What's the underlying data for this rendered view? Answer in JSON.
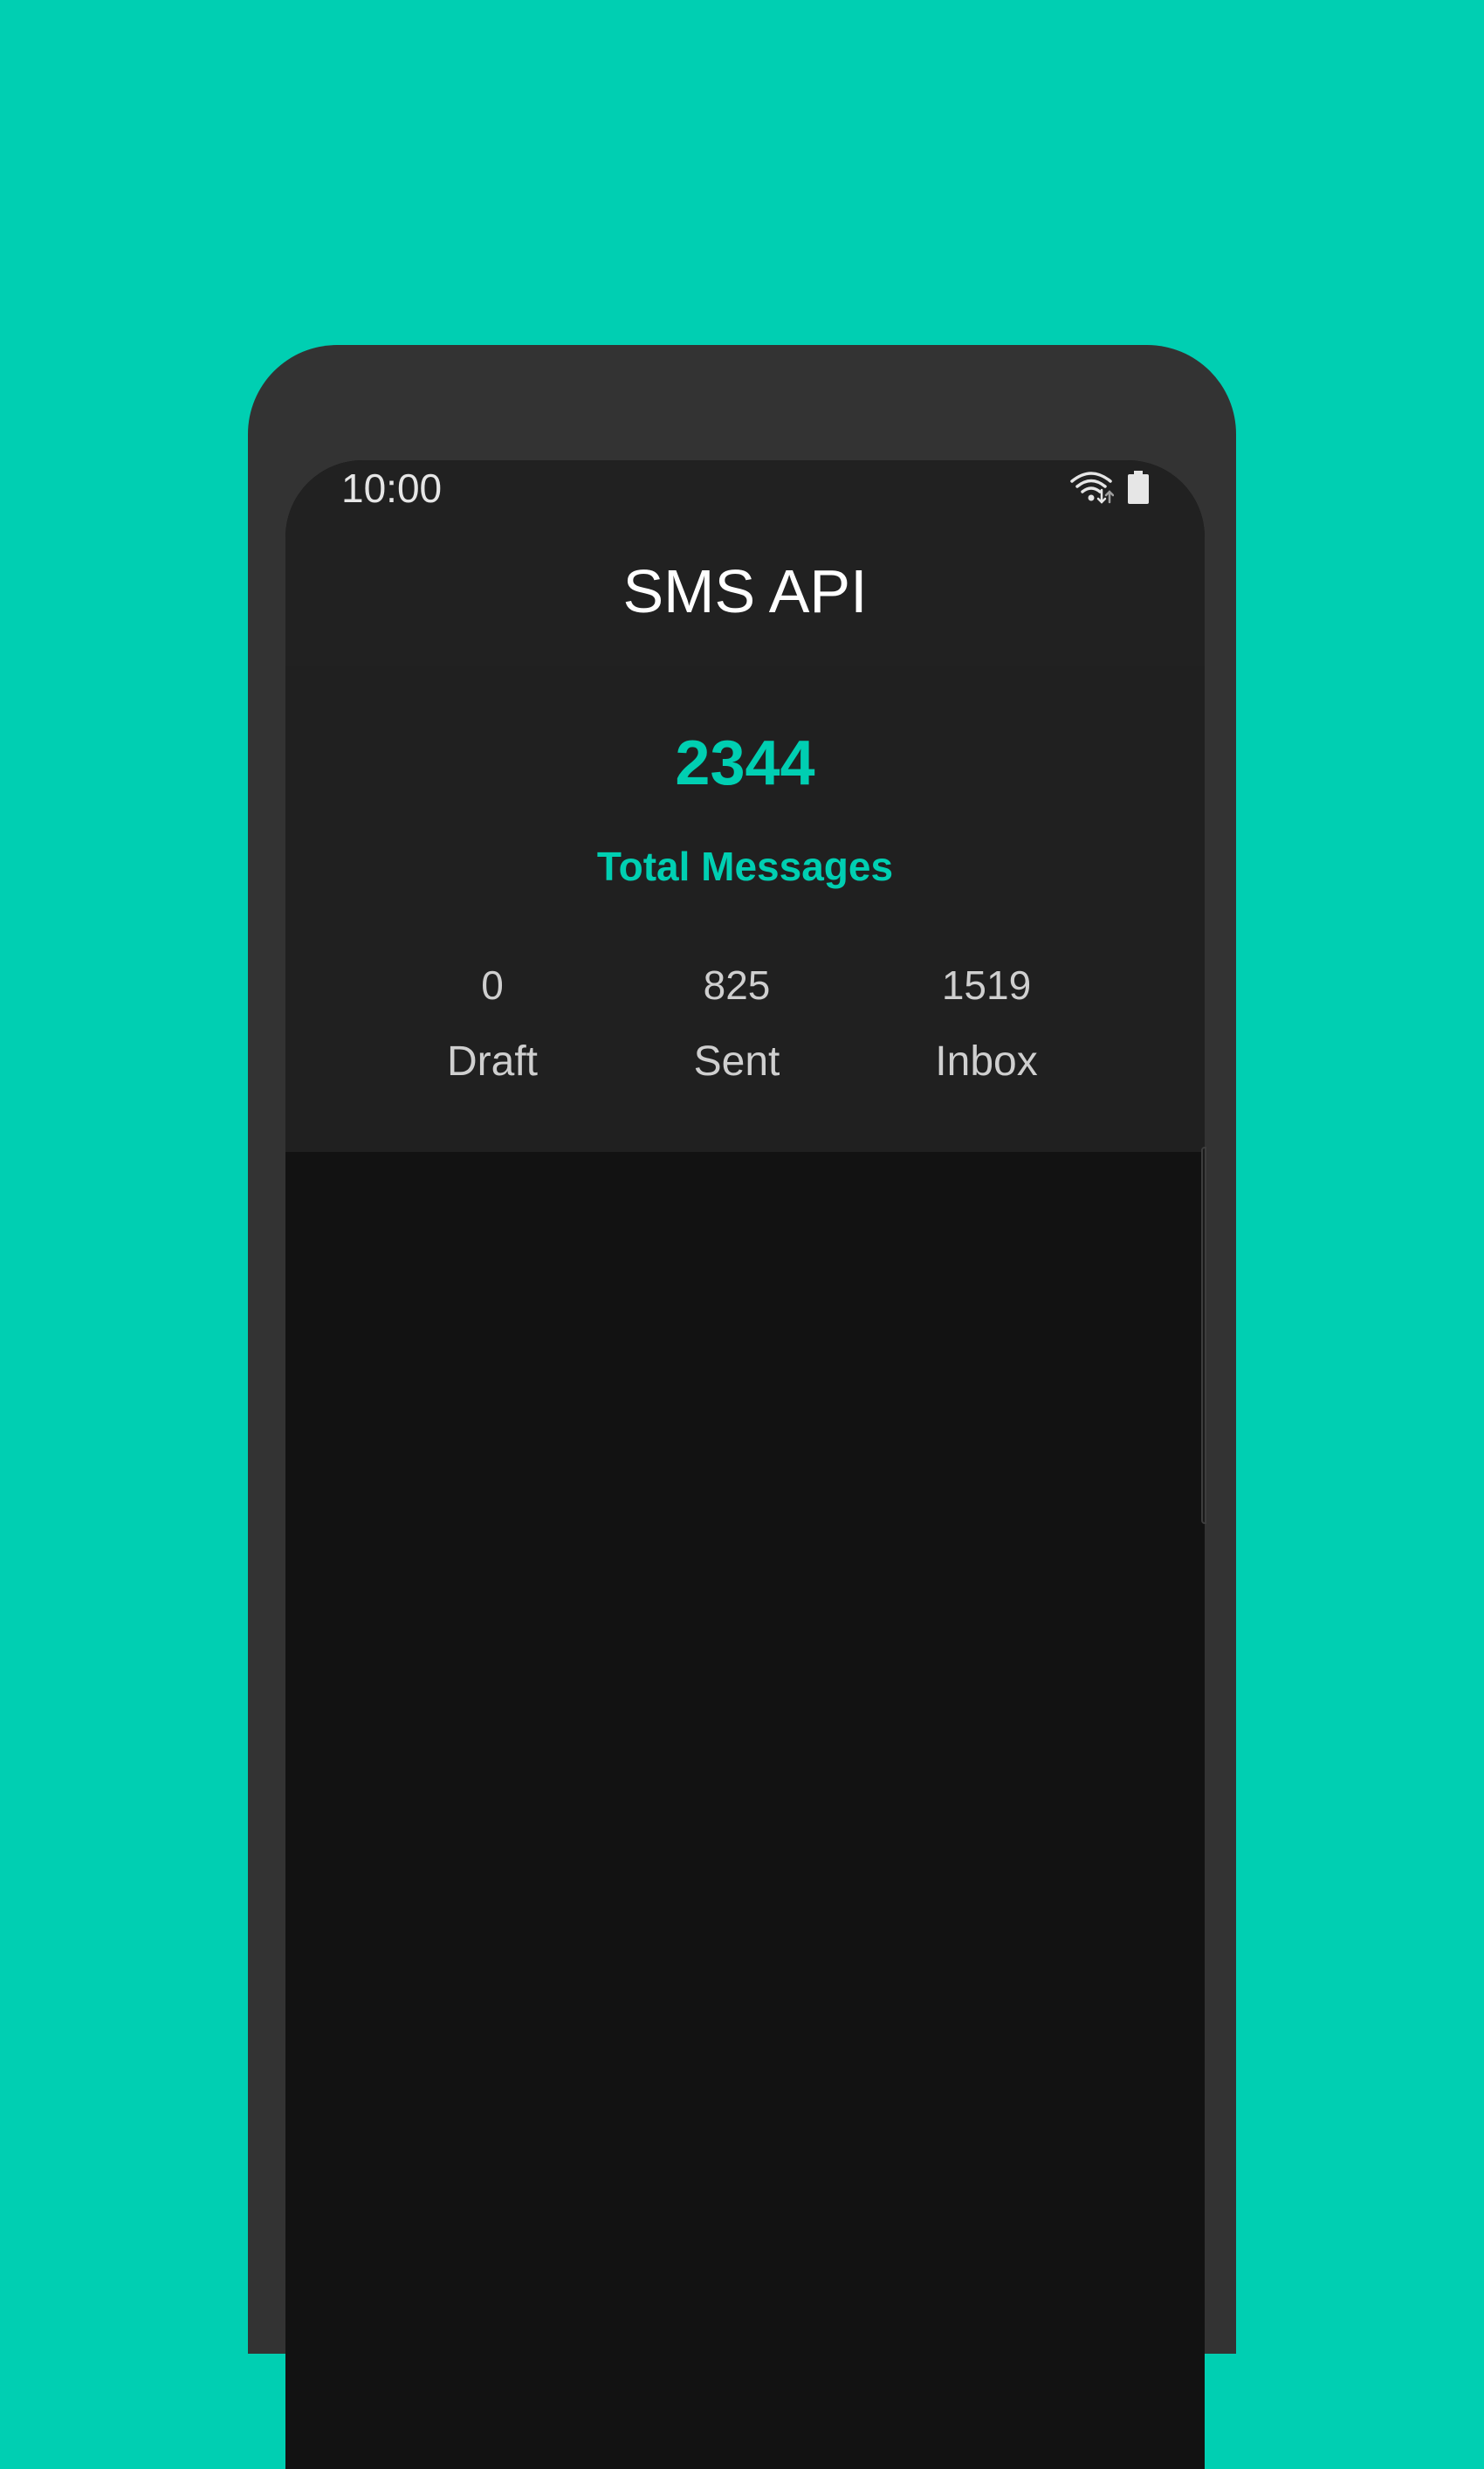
{
  "status_bar": {
    "time": "10:00",
    "icons": [
      "wifi-icon",
      "battery-icon"
    ]
  },
  "app_bar": {
    "title": "SMS API"
  },
  "summary": {
    "total": "2344",
    "total_label": "Total Messages",
    "items": [
      {
        "value": "0",
        "label": "Draft"
      },
      {
        "value": "825",
        "label": "Sent"
      },
      {
        "value": "1519",
        "label": "Inbox"
      }
    ]
  },
  "colors": {
    "background": "#00CFB2",
    "accent": "#00CFB2",
    "device_frame": "#333333",
    "app_bar": "#212121",
    "content": "#121212"
  }
}
